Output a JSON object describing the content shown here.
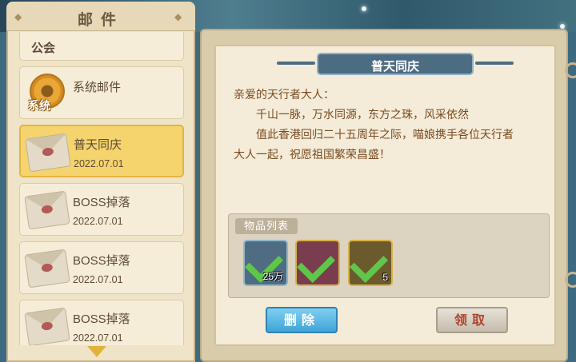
{
  "left_panel": {
    "title": "邮件",
    "mails": [
      {
        "title": "",
        "label": "公会",
        "kind": "guild"
      },
      {
        "title": "系统邮件",
        "label": "系统",
        "kind": "system"
      },
      {
        "title": "普天同庆",
        "date": "2022.07.01",
        "kind": "letter",
        "selected": true
      },
      {
        "title": "BOSS掉落",
        "date": "2022.07.01",
        "kind": "letter"
      },
      {
        "title": "BOSS掉落",
        "date": "2022.07.01",
        "kind": "letter"
      },
      {
        "title": "BOSS掉落",
        "date": "2022.07.01",
        "kind": "letter"
      }
    ]
  },
  "mail_detail": {
    "title": "普天同庆",
    "greeting": "亲爱的天行者大人：",
    "line1": "千山一脉，万水同源，东方之珠，风采依然",
    "line2": "值此香港回归二十五周年之际，喵娘携手各位天行者",
    "line3": "大人一起，祝愿祖国繁荣昌盛！",
    "items_label": "物品列表",
    "items": [
      {
        "name": "ore-item-icon",
        "count": "25万",
        "bg": "#4f6c82"
      },
      {
        "name": "gem-item-icon",
        "count": "",
        "bg": "#7a3c4f"
      },
      {
        "name": "book-item-icon",
        "count": "5",
        "bg": "#6b5a2c"
      }
    ],
    "delete_label": "删除",
    "claim_label": "领取"
  },
  "colors": {
    "selected_bg": "#f5d46e",
    "delete_btn": "#3fa5d8",
    "claim_text": "#b0412f"
  }
}
